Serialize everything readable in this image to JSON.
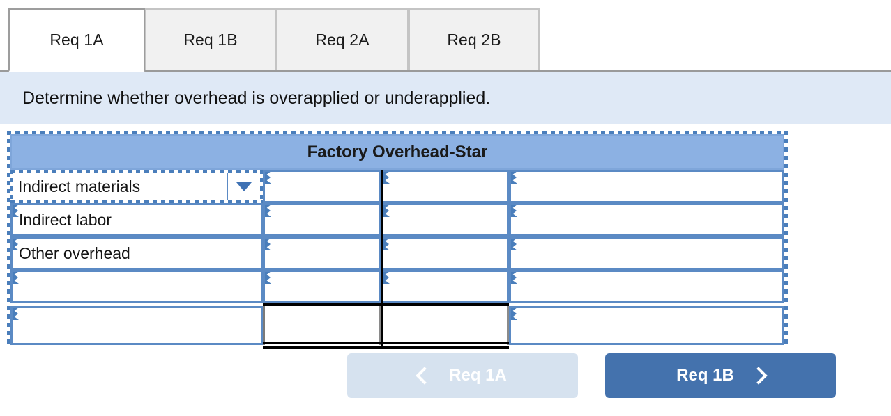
{
  "tabs": [
    {
      "label": "Req 1A",
      "active": true
    },
    {
      "label": "Req 1B",
      "active": false
    },
    {
      "label": "Req 2A",
      "active": false
    },
    {
      "label": "Req 2B",
      "active": false
    }
  ],
  "instruction": {
    "text": "Determine whether overhead is overapplied or underapplied."
  },
  "sheet": {
    "title": "Factory Overhead-Star",
    "rows": [
      {
        "label": "Indirect materials",
        "selected": true,
        "has_dropdown": true,
        "col1": "",
        "col2": "",
        "col3": ""
      },
      {
        "label": "Indirect labor",
        "selected": false,
        "has_dropdown": false,
        "col1": "",
        "col2": "",
        "col3": ""
      },
      {
        "label": "Other overhead",
        "selected": false,
        "has_dropdown": false,
        "col1": "",
        "col2": "",
        "col3": ""
      },
      {
        "label": "",
        "selected": false,
        "has_dropdown": false,
        "col1": "",
        "col2": "",
        "col3": ""
      },
      {
        "label": "",
        "selected": false,
        "has_dropdown": false,
        "col1": "",
        "col2": "",
        "col3": ""
      }
    ]
  },
  "nav": {
    "prev_label": "Req 1A",
    "next_label": "Req 1B",
    "prev_icon": "chevron-left-icon",
    "next_icon": "chevron-right-icon",
    "prev_disabled": true
  },
  "colors": {
    "header_blue": "#8cb1e3",
    "instruction_blue": "#dfe9f6",
    "cell_border_blue": "#5b8ac4",
    "selection_blue": "#4a7ebb",
    "next_button_blue": "#4472ad",
    "prev_button_blue": "#d6e2ef",
    "tab_inactive_gray": "#f1f1f1"
  }
}
